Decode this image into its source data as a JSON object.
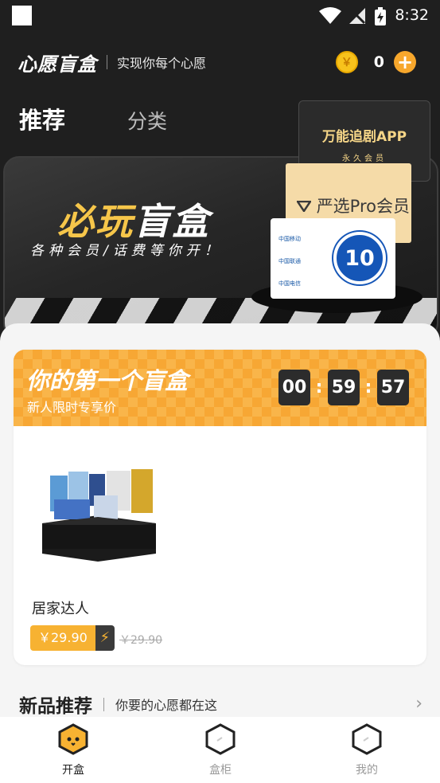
{
  "status_bar": {
    "time": "8:32"
  },
  "header": {
    "brand": "心愿盲盒",
    "slogan": "实现你每个心愿",
    "coin_count": "0"
  },
  "tabs": [
    {
      "label": "推荐"
    },
    {
      "label": "分类"
    }
  ],
  "banner": {
    "title_a": "必玩",
    "title_b": "盲盒",
    "subtitle": "各种会员/话费等你开！",
    "card_app_title": "万能追剧APP",
    "card_app_sub": "永久会员",
    "card_pro": "严选Pro会员",
    "operators": [
      "中国移动",
      "中国联通",
      "中国电信"
    ],
    "badge_value": "10"
  },
  "promo": {
    "title": "你的第一个盲盒",
    "subtitle": "新人限时专享价",
    "timer": {
      "hours": "00",
      "minutes": "59",
      "seconds": "57"
    },
    "product_name": "居家达人",
    "price": "￥29.90",
    "old_price": "￥29.90"
  },
  "section": {
    "title": "新品推荐",
    "desc": "你要的心愿都在这"
  },
  "nav": [
    {
      "label": "开盒",
      "active": true
    },
    {
      "label": "盒柜",
      "active": false
    },
    {
      "label": "我的",
      "active": false
    }
  ],
  "colors": {
    "accent": "#f7a734",
    "dark": "#1f1f1f",
    "gold": "#f6c64a"
  }
}
